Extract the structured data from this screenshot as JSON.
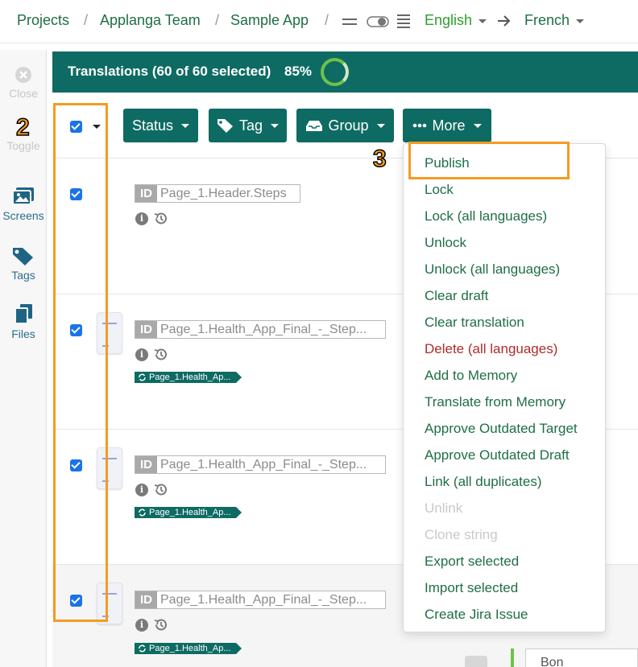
{
  "breadcrumb": {
    "items": [
      "Projects",
      "Applanga Team",
      "Sample App"
    ],
    "separator": "/",
    "source_language": "English",
    "target_language": "French"
  },
  "sidebar": {
    "items": [
      {
        "label": "Close",
        "icon": "close-icon",
        "enabled": false
      },
      {
        "label": "Toggle",
        "icon": "toggle-icon",
        "enabled": false
      },
      {
        "label": "Screens",
        "icon": "screens-icon",
        "enabled": true
      },
      {
        "label": "Tags",
        "icon": "tags-icon",
        "enabled": true
      },
      {
        "label": "Files",
        "icon": "files-icon",
        "enabled": true
      }
    ]
  },
  "header": {
    "title": "Translations (60 of 60 selected)",
    "progress_label": "85%",
    "progress": 0.85
  },
  "toolbar": {
    "status_label": "Status",
    "tag_label": "Tag",
    "group_label": "Group",
    "more_label": "More"
  },
  "rows": [
    {
      "id_tag": "ID",
      "key": "Page_1.Header.Steps",
      "chip": "",
      "checked": true
    },
    {
      "id_tag": "ID",
      "key": "Page_1.Health_App_Final_-_Step...",
      "chip": "Page_1.Health_Ap...",
      "checked": true
    },
    {
      "id_tag": "ID",
      "key": "Page_1.Health_App_Final_-_Step...",
      "chip": "Page_1.Health_Ap...",
      "checked": true
    },
    {
      "id_tag": "ID",
      "key": "Page_1.Health_App_Final_-_Step...",
      "chip": "Page_1.Health_Ap...",
      "checked": true
    }
  ],
  "more_menu": {
    "items": [
      {
        "label": "Publish",
        "state": "normal"
      },
      {
        "label": "Lock",
        "state": "normal"
      },
      {
        "label": "Lock (all languages)",
        "state": "normal"
      },
      {
        "label": "Unlock",
        "state": "normal"
      },
      {
        "label": "Unlock (all languages)",
        "state": "normal"
      },
      {
        "label": "Clear draft",
        "state": "normal"
      },
      {
        "label": "Clear translation",
        "state": "normal"
      },
      {
        "label": "Delete (all languages)",
        "state": "danger"
      },
      {
        "label": "Add to Memory",
        "state": "normal"
      },
      {
        "label": "Translate from Memory",
        "state": "normal"
      },
      {
        "label": "Approve Outdated Target",
        "state": "normal"
      },
      {
        "label": "Approve Outdated Draft",
        "state": "normal"
      },
      {
        "label": "Link (all duplicates)",
        "state": "normal"
      },
      {
        "label": "Unlink",
        "state": "disabled"
      },
      {
        "label": "Clone string",
        "state": "disabled"
      },
      {
        "label": "Export selected",
        "state": "normal"
      },
      {
        "label": "Import selected",
        "state": "normal"
      },
      {
        "label": "Create Jira Issue",
        "state": "normal"
      }
    ]
  },
  "annotations": {
    "step_2": "2",
    "step_3": "3",
    "color": "#f59a23"
  },
  "bottom_fragments": {
    "partial_text": "Bon"
  },
  "colors": {
    "teal": "#0e6b63",
    "link_green": "#1f6e46",
    "language_green": "#2e9e2e",
    "danger": "#b02a2a",
    "checkbox": "#1a73e8",
    "progress_ring": "#6fc24a"
  }
}
